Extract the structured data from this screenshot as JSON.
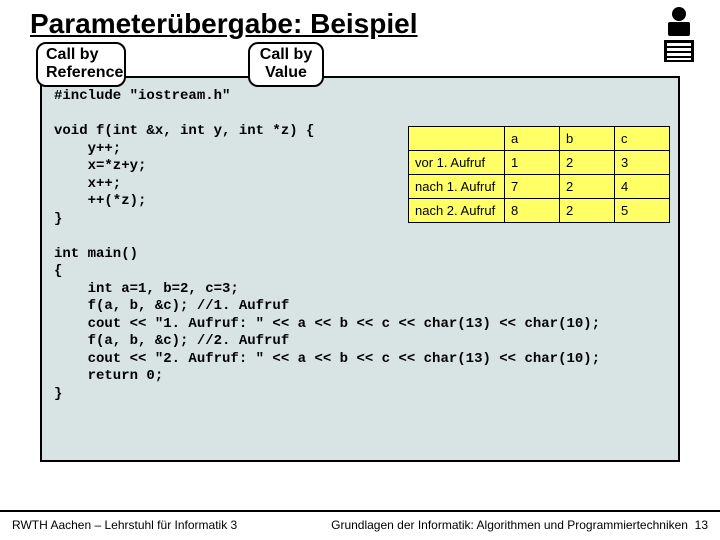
{
  "title": "Parameterübergabe: Beispiel",
  "callboxes": {
    "ref": "Call by\nReference",
    "val": "Call by\nValue"
  },
  "code": "#include \"iostream.h\"\n\nvoid f(int &x, int y, int *z) {\n    y++;\n    x=*z+y;\n    x++;\n    ++(*z);\n}\n\nint main()\n{\n    int a=1, b=2, c=3;\n    f(a, b, &c); //1. Aufruf\n    cout << \"1. Aufruf: \" << a << b << c << char(13) << char(10);\n    f(a, b, &c); //2. Aufruf\n    cout << \"2. Aufruf: \" << a << b << c << char(13) << char(10);\n    return 0;\n}",
  "table": {
    "headers": [
      "",
      "a",
      "b",
      "c"
    ],
    "rows": [
      [
        "vor 1. Aufruf",
        "1",
        "2",
        "3"
      ],
      [
        "nach 1. Aufruf",
        "7",
        "2",
        "4"
      ],
      [
        "nach 2. Aufruf",
        "8",
        "2",
        "5"
      ]
    ]
  },
  "footer": {
    "left": "RWTH Aachen – Lehrstuhl für Informatik 3",
    "right_text": "Grundlagen der Informatik: Algorithmen und Programmiertechniken",
    "page": "13"
  }
}
